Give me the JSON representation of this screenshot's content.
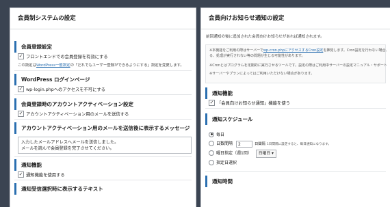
{
  "left": {
    "title": "会員制システムの設定",
    "sec1": {
      "title": "会員登録設定",
      "checkbox": "フロントエンドでの会員登録を有効にする",
      "note_pre": "この設定は",
      "note_link": "WordPress一般設定",
      "note_post": "の「だれでもユーザー登録ができるようにする」設定を変更します。"
    },
    "sec2": {
      "title": "WordPress ログインページ",
      "checkbox": "wp-login.phpへのアクセスを不可にする"
    },
    "sec3": {
      "title": "会員登録時のアカウントアクティベーション設定",
      "checkbox": "アカウントアクティベーション用のメールを送信する"
    },
    "sec4": {
      "title": "アカウントアクティベーション用のメールを送信後に表示するメッセージ",
      "line1": "入力したメールアドレスへメールを送信しました。",
      "line2": "メールを読んで会員登録を完了させてください。"
    },
    "sec5": {
      "title": "通知機能",
      "checkbox": "通知機能を使用する"
    },
    "sec6": {
      "title": "通知受信選択時に表示するテキスト"
    }
  },
  "right": {
    "title": "会員向けお知らせ通知の設定",
    "intro": "前回通知の後に追加された会員向けお知らせがあれば通知されます。",
    "info1_pre": "※本機能をご利用の際はサーバーで",
    "info1_link": "wp-cron.phpにアクセスするCron設定",
    "info1_post": "を推奨します。Cron設定を行わない場合、",
    "info2": "る、処理が実行されない等の問題が生じる可能性があります。",
    "info3": "※Cronとはプログラムを定期的に実行させるツールです。設定の際はご利用中サーバーの設定マニュアル・サポート",
    "info4": "※サーバーやプランによってはご利用いただけない場合があります。",
    "notify_title": "通知機能",
    "notify_checkbox": "「会員向けお知らせ通知」機能を使う",
    "schedule_title": "通知スケジュール",
    "opt_daily": "毎日",
    "opt_interval": "日数間隔",
    "interval_value": "2",
    "interval_note_bold": "日間隔",
    "interval_note": "1日間隔に設定すると、毎日通知になります。",
    "opt_weekday": "曜日指定（週1回）",
    "weekday_value": "日曜日",
    "opt_date": "指定日選択",
    "time_title": "通知時間"
  }
}
